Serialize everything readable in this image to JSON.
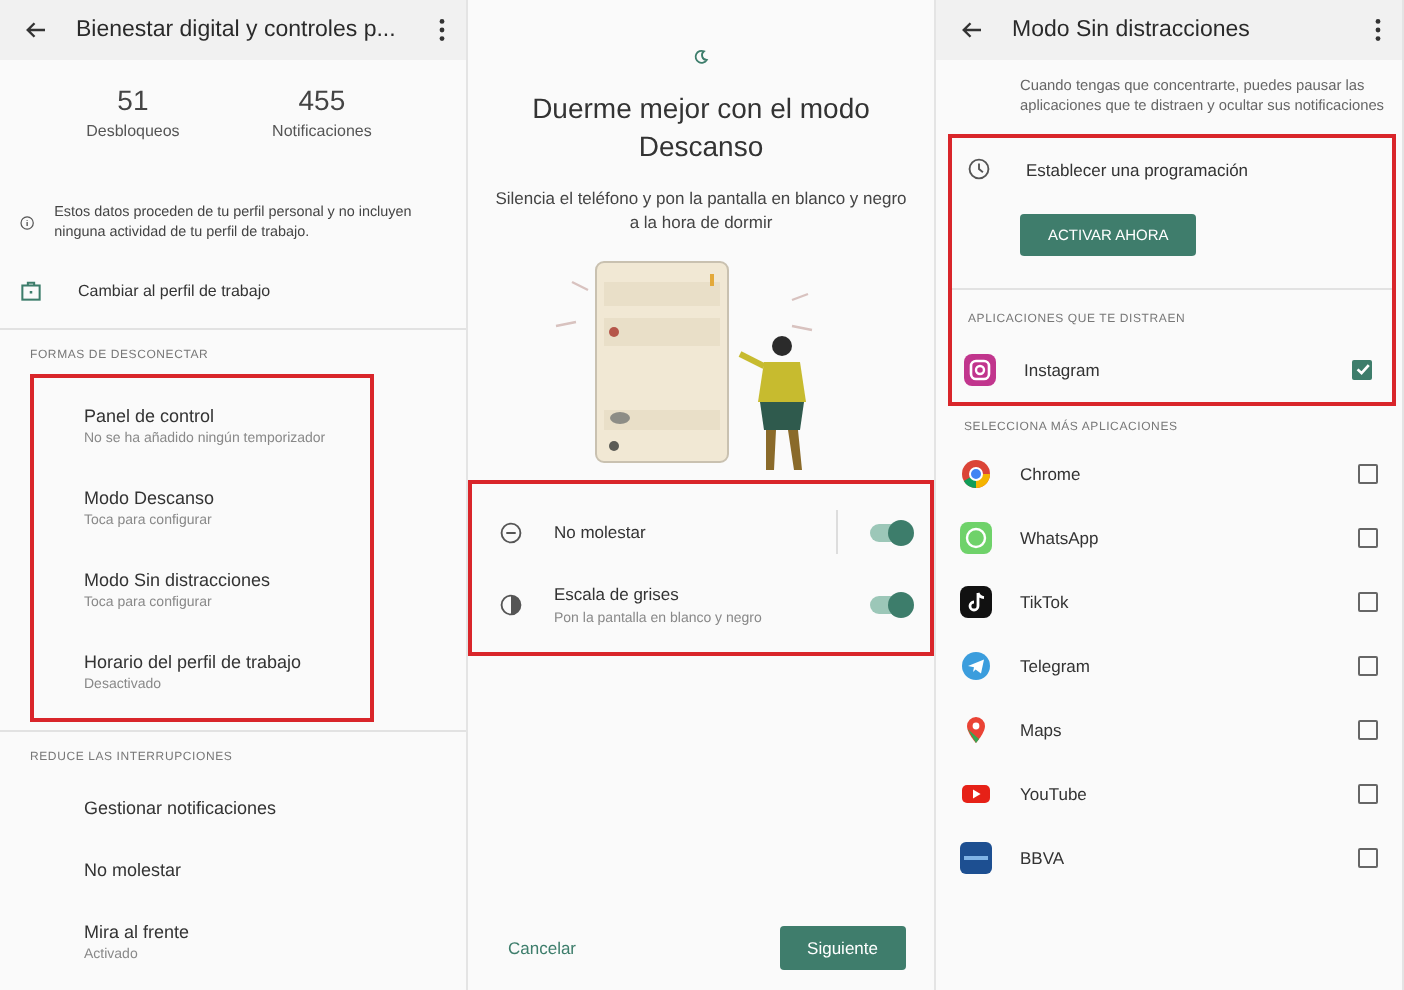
{
  "wellbeing_screen": {
    "app_bar": {
      "title": "Bienestar digital y controles p..."
    },
    "stats": [
      {
        "value": "51",
        "label": "Desbloqueos"
      },
      {
        "value": "455",
        "label": "Notificaciones"
      }
    ],
    "info_note": "Estos datos proceden de tu perfil personal y no incluyen ninguna actividad de tu perfil de trabajo.",
    "work_profile_link": "Cambiar al perfil de trabajo",
    "sections": [
      {
        "header": "FORMAS DE DESCONECTAR",
        "highlighted": true,
        "items": [
          {
            "title": "Panel de control",
            "subtitle": "No se ha añadido ningún temporizador"
          },
          {
            "title": "Modo Descanso",
            "subtitle": "Toca para configurar"
          },
          {
            "title": "Modo Sin distracciones",
            "subtitle": "Toca para configurar"
          },
          {
            "title": "Horario del perfil de trabajo",
            "subtitle": "Desactivado"
          }
        ]
      },
      {
        "header": "REDUCE LAS INTERRUPCIONES",
        "highlighted": false,
        "items": [
          {
            "title": "Gestionar notificaciones"
          },
          {
            "title": "No molestar"
          },
          {
            "title": "Mira al frente",
            "subtitle": "Activado"
          }
        ]
      }
    ]
  },
  "bedtime_screen": {
    "title": "Duerme mejor con el modo Descanso",
    "description": "Silencia el teléfono y pon la pantalla en blanco y negro a la hora de dormir",
    "settings_highlighted": true,
    "settings": [
      {
        "kind": "split",
        "label": "No molestar",
        "on": true
      },
      {
        "kind": "plain",
        "label": "Escala de grises",
        "subtitle": "Pon la pantalla en blanco y negro",
        "on": true
      }
    ],
    "cancel_button": "Cancelar",
    "next_button": "Siguiente"
  },
  "focus_screen": {
    "app_bar": {
      "title": "Modo Sin distracciones"
    },
    "description": "Cuando tengas que concentrarte, puedes pausar las aplicaciones que te distraen y ocultar sus notificaciones",
    "highlighted": true,
    "schedule_link": "Establecer una programación",
    "activate_button": "ACTIVAR AHORA",
    "distracting_header": "APLICACIONES QUE TE DISTRAEN",
    "distracting_apps": [
      {
        "kind": "instagram",
        "name": "Instagram",
        "checked": true
      }
    ],
    "more_header": "SELECCIONA MÁS APLICACIONES",
    "more_apps": [
      {
        "kind": "chrome",
        "name": "Chrome",
        "checked": false
      },
      {
        "kind": "whatsapp",
        "name": "WhatsApp",
        "checked": false
      },
      {
        "kind": "tiktok",
        "name": "TikTok",
        "checked": false
      },
      {
        "kind": "telegram",
        "name": "Telegram",
        "checked": false
      },
      {
        "kind": "maps",
        "name": "Maps",
        "checked": false
      },
      {
        "kind": "youtube",
        "name": "YouTube",
        "checked": false
      },
      {
        "kind": "bbva",
        "name": "BBVA",
        "checked": false
      }
    ]
  }
}
